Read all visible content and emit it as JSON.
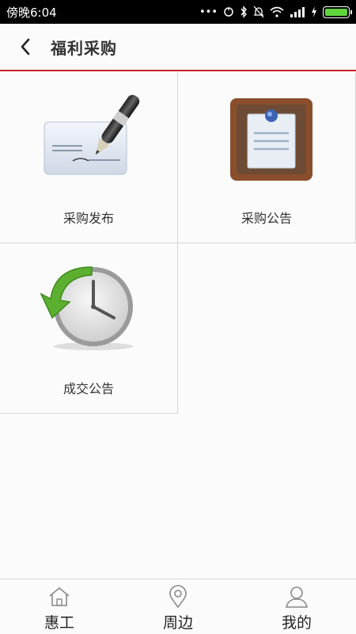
{
  "status_bar": {
    "time": "傍晚6:04",
    "icons": [
      "more-dots-icon",
      "sync-icon",
      "bluetooth-icon",
      "mute-icon",
      "wifi-icon",
      "signal-icon",
      "charging-icon",
      "battery-icon"
    ],
    "battery_color": "#5fd43c"
  },
  "header": {
    "title": "福利采购",
    "accent_color": "#c8202a"
  },
  "grid": {
    "items": [
      {
        "label": "采购发布",
        "icon": "pen-check-icon"
      },
      {
        "label": "采购公告",
        "icon": "notice-board-icon"
      },
      {
        "label": "成交公告",
        "icon": "clock-arrow-icon"
      }
    ]
  },
  "tab_bar": {
    "tabs": [
      {
        "label": "惠工",
        "icon": "home-icon"
      },
      {
        "label": "周边",
        "icon": "location-pin-icon"
      },
      {
        "label": "我的",
        "icon": "user-icon"
      }
    ]
  }
}
